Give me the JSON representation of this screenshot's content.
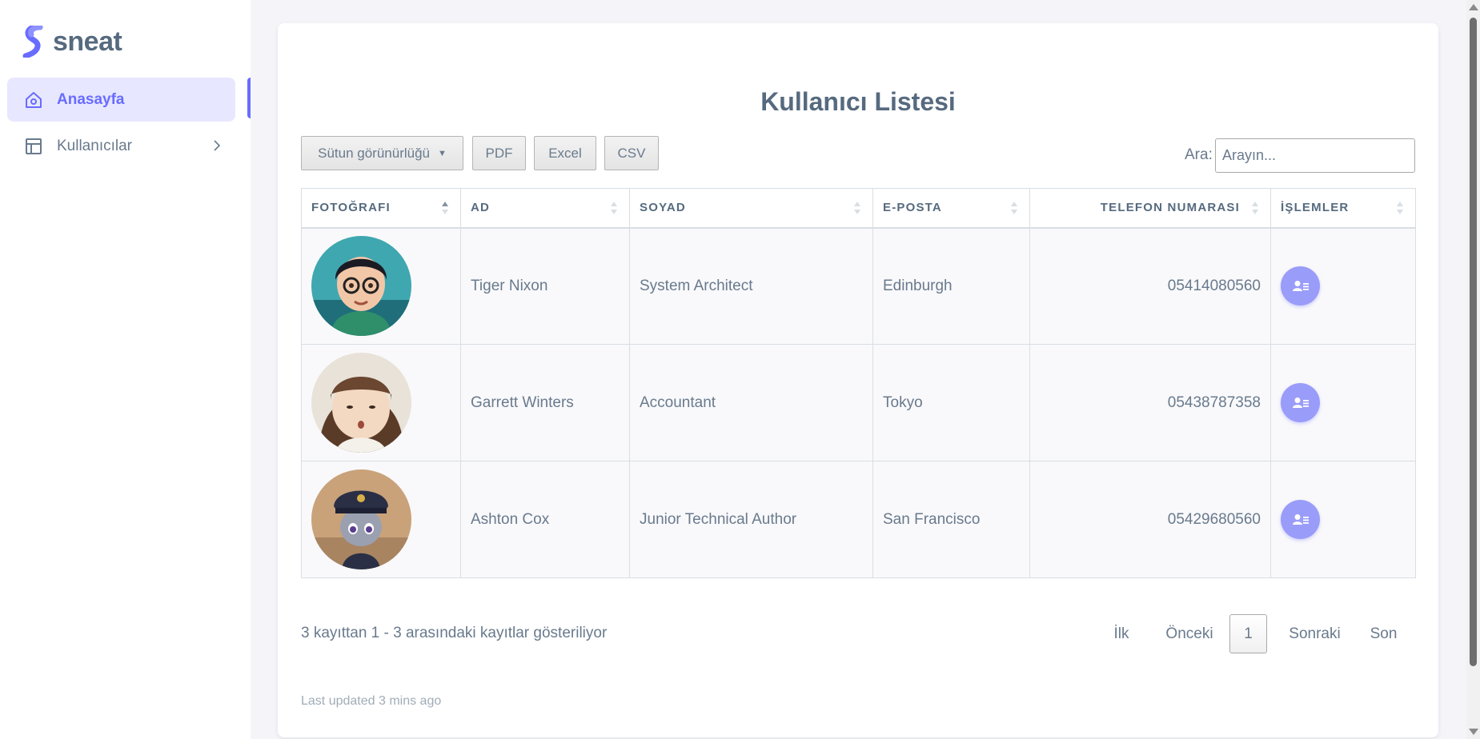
{
  "brand": {
    "name": "sneat",
    "logo_color": "#696cff",
    "logo_icon": "s-logo-icon"
  },
  "sidebar": {
    "items": [
      {
        "label": "Anasayfa",
        "icon": "home-icon",
        "active": true
      },
      {
        "label": "Kullanıcılar",
        "icon": "layout-icon",
        "has_submenu": true
      }
    ]
  },
  "main": {
    "title": "Kullanıcı Listesi",
    "toolbar": {
      "column_visibility_label": "Sütun görünürlüğü",
      "pdf_label": "PDF",
      "excel_label": "Excel",
      "csv_label": "CSV",
      "search_label": "Ara:",
      "search_placeholder": "Arayın..."
    },
    "table": {
      "headers": [
        "FOTOĞRAFI",
        "AD",
        "SOYAD",
        "E-POSTA",
        "TELEFON NUMARASI",
        "İŞLEMLER"
      ],
      "sorted_column": "FOTOĞRAFI",
      "rows": [
        {
          "photo": "avatar-girl-glasses",
          "ad": "Tiger Nixon",
          "soyad": "System Architect",
          "eposta": "Edinburgh",
          "telefon": "05414080560",
          "action_icon": "user-details-icon"
        },
        {
          "photo": "avatar-girl-bangs",
          "ad": "Garrett Winters",
          "soyad": "Accountant",
          "eposta": "Tokyo",
          "telefon": "05438787358",
          "action_icon": "user-details-icon"
        },
        {
          "photo": "avatar-bunny-police",
          "ad": "Ashton Cox",
          "soyad": "Junior Technical Author",
          "eposta": "San Francisco",
          "telefon": "05429680560",
          "action_icon": "user-details-icon"
        }
      ]
    },
    "info": "3 kayıttan 1 - 3 arasındaki kayıtlar gösteriliyor",
    "pagination": {
      "first": "İlk",
      "previous": "Önceki",
      "current": "1",
      "next": "Sonraki",
      "last": "Son"
    },
    "footer_note": "Last updated 3 mins ago"
  },
  "colors": {
    "accent": "#696cff",
    "action_button": "#9a9cf9",
    "page_bg": "#f5f5f9",
    "text": "#697a8d",
    "heading": "#566a7f"
  }
}
